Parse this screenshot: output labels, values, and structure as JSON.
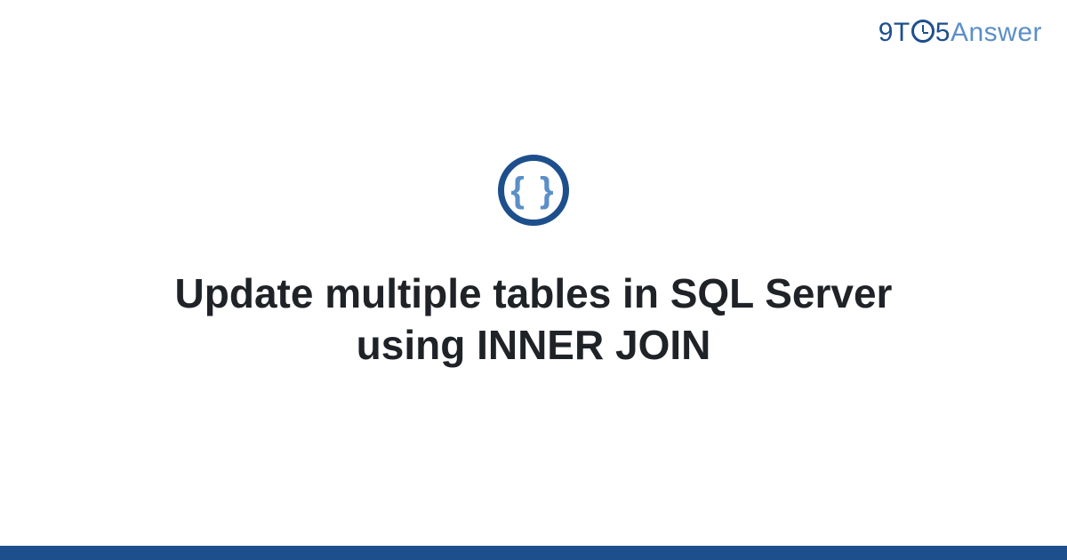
{
  "logo": {
    "part1": "9T",
    "part2": "5",
    "part3": "Answer"
  },
  "icon": {
    "braces": "{ }"
  },
  "title": "Update multiple tables in SQL Server using INNER JOIN",
  "colors": {
    "primary": "#1d4f8c",
    "secondary": "#5b8fc7",
    "text": "#1f2328"
  }
}
